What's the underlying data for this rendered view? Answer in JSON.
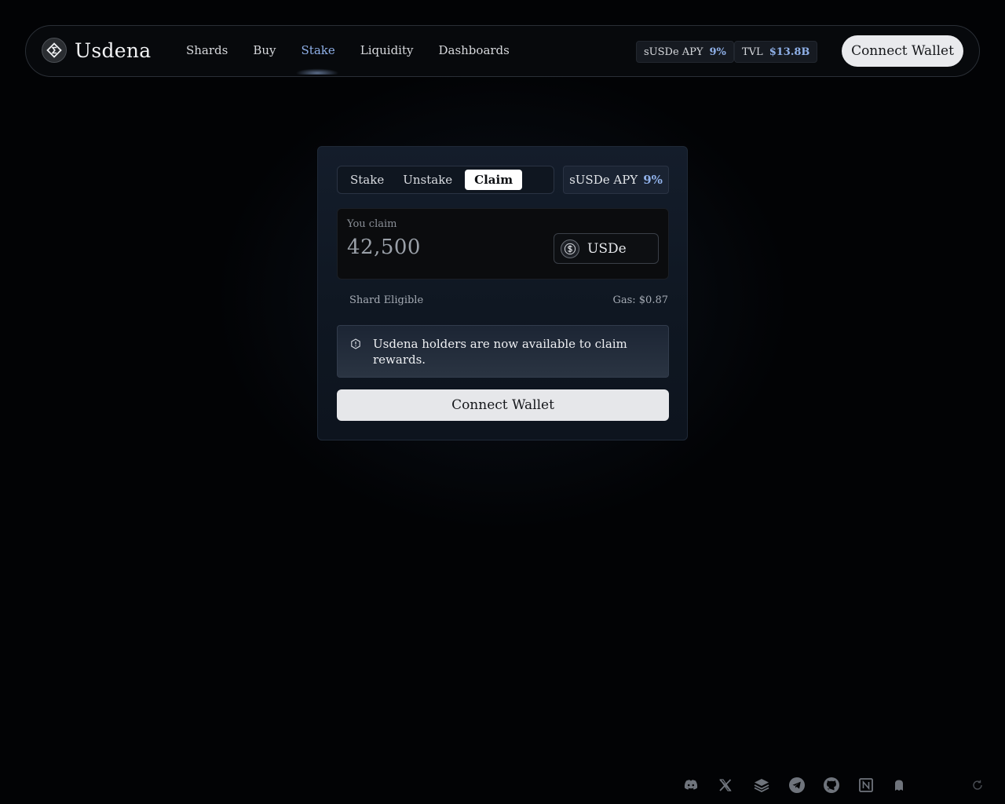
{
  "brand": {
    "name": "Usdena"
  },
  "nav": {
    "links": [
      "Shards",
      "Buy",
      "Stake",
      "Liquidity",
      "Dashboards"
    ],
    "active_index": 2,
    "stats": [
      {
        "label": "sUSDe APY",
        "value": "9%"
      },
      {
        "label": "TVL",
        "value": "$13.8B"
      }
    ],
    "cta": "Connect Wallet"
  },
  "card": {
    "tabs": [
      "Stake",
      "Unstake",
      "Claim"
    ],
    "active_tab": "Claim",
    "apy": {
      "label": "sUSDe APY",
      "value": "9%"
    },
    "claim": {
      "label": "You claim",
      "amount": "42,500",
      "token": "USDe"
    },
    "shard_text": "Shard Eligible",
    "gas_text": "Gas: $0.87",
    "notice": "Usdena holders are now available to claim rewards.",
    "cta": "Connect Wallet"
  },
  "footer": {
    "icons": [
      "discord-icon",
      "x-icon",
      "layers-icon",
      "telegram-icon",
      "github-icon",
      "notion-icon",
      "ghost-icon",
      "refresh-icon"
    ]
  },
  "colors": {
    "accent": "#8fb0e8",
    "background": "#020305",
    "button": "#e6e7ea"
  }
}
